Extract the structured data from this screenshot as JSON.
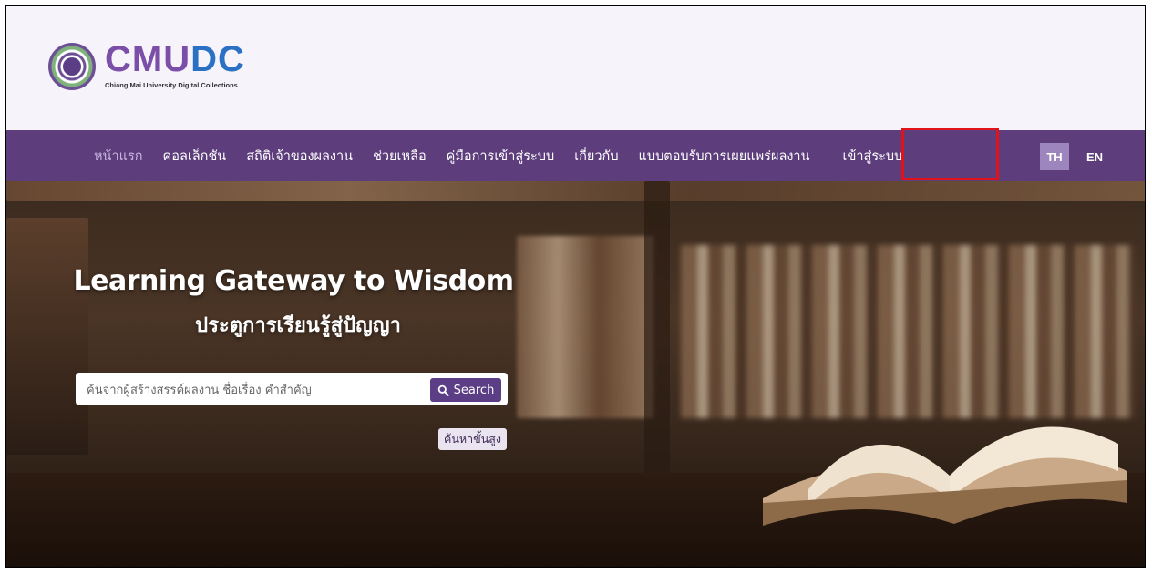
{
  "brand": {
    "logo_text_1": "CMU",
    "logo_text_2": "DC",
    "tagline": "Chiang Mai University Digital Collections"
  },
  "nav": {
    "items": [
      {
        "label": "หน้าแรก"
      },
      {
        "label": "คอลเล็กชัน"
      },
      {
        "label": "สถิติเจ้าของผลงาน"
      },
      {
        "label": "ช่วยเหลือ"
      },
      {
        "label": "คู่มือการเข้าสู่ระบบ"
      },
      {
        "label": "เกี่ยวกับ"
      },
      {
        "label": "แบบตอบรับการเผยแพร่ผลงาน"
      },
      {
        "label": "เข้าสู่ระบบ"
      }
    ],
    "lang_th": "TH",
    "lang_en": "EN"
  },
  "hero": {
    "title": "Learning Gateway to Wisdom",
    "subtitle": "ประตูการเรียนรู้สู่ปัญญา",
    "search_placeholder": "ค้นจากผู้สร้างสรรค์ผลงาน ชื่อเรื่อง คำสำคัญ",
    "search_button": "Search",
    "advanced_search": "ค้นหาขั้นสูง"
  },
  "colors": {
    "nav_bg": "#5d3d7c",
    "accent": "#5b3e86",
    "highlight": "#e0131a"
  }
}
